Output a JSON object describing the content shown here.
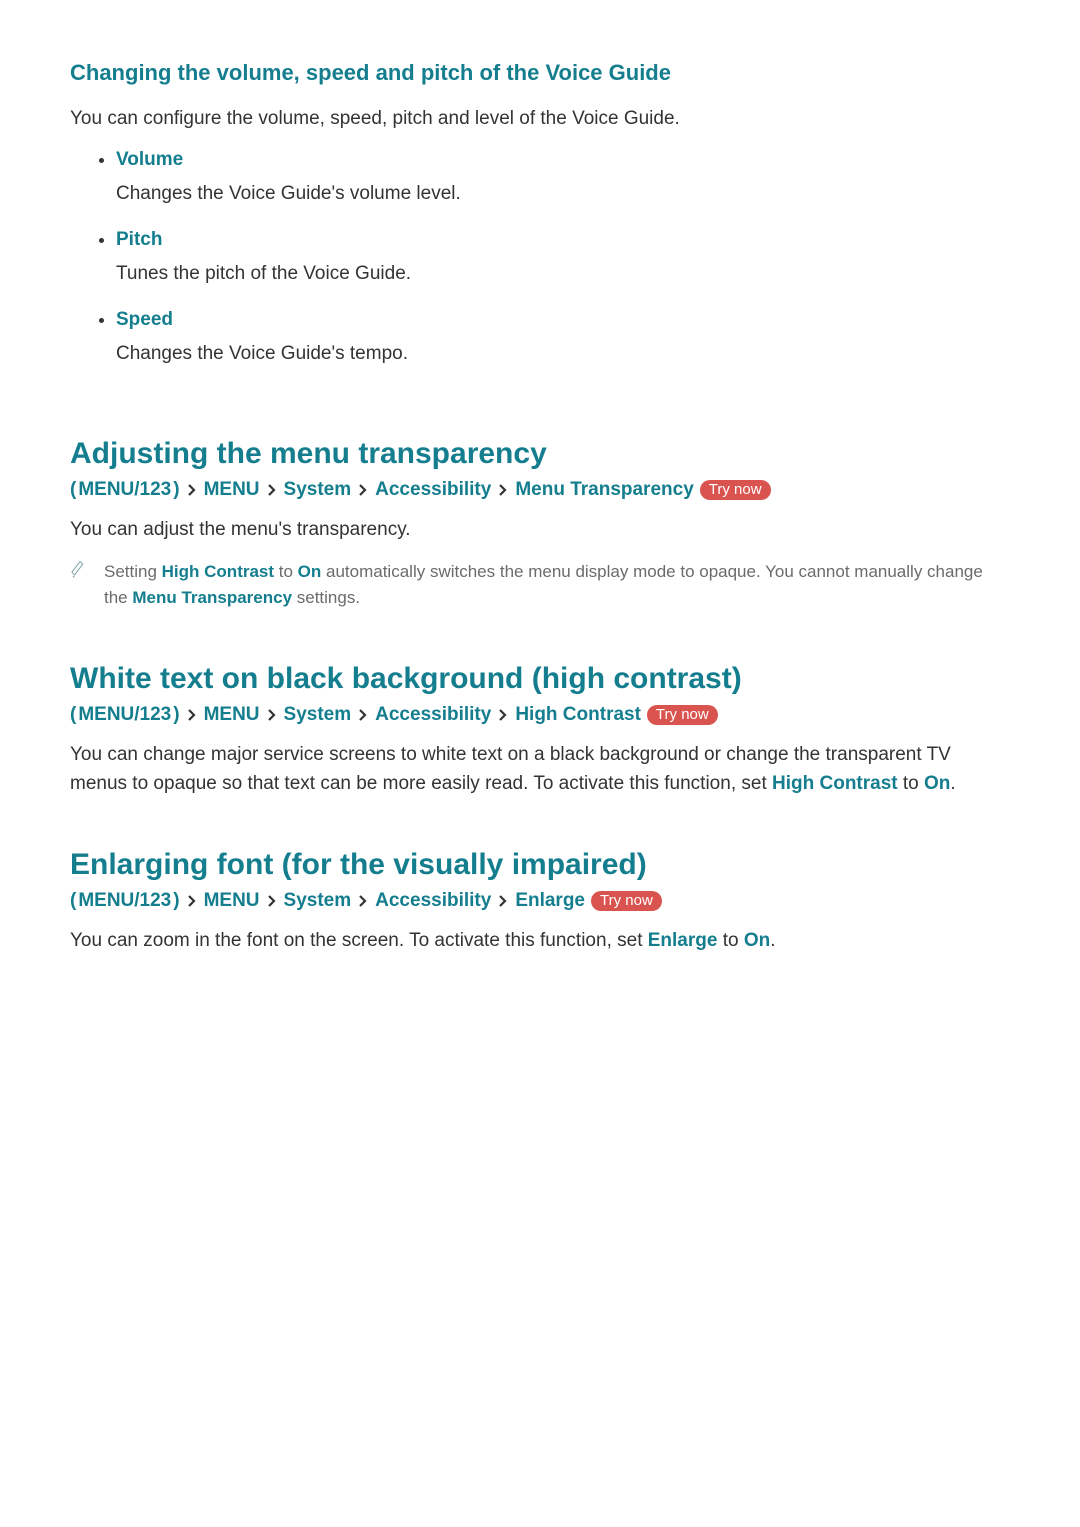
{
  "section1": {
    "heading": "Changing the volume, speed and pitch of the Voice Guide",
    "intro": "You can configure the volume, speed, pitch and level of the Voice Guide.",
    "options": [
      {
        "name": "Volume",
        "desc": "Changes the Voice Guide's volume level."
      },
      {
        "name": "Pitch",
        "desc": "Tunes the pitch of the Voice Guide."
      },
      {
        "name": "Speed",
        "desc": "Changes the Voice Guide's tempo."
      }
    ]
  },
  "section2": {
    "heading": "Adjusting the menu transparency",
    "breadcrumb": {
      "root_prefix": "(",
      "root": "MENU/123",
      "root_suffix": ")",
      "steps": [
        "MENU",
        "System",
        "Accessibility",
        "Menu Transparency"
      ],
      "try_now": "Try now"
    },
    "body": "You can adjust the menu's transparency.",
    "note": {
      "pre": "Setting ",
      "kw1": "High Contrast",
      "mid1": " to ",
      "kw2": "On",
      "mid2": " automatically switches the menu display mode to opaque. You cannot manually change the ",
      "kw3": "Menu Transparency",
      "post": " settings."
    }
  },
  "section3": {
    "heading": "White text on black background (high contrast)",
    "breadcrumb": {
      "root_prefix": "(",
      "root": "MENU/123",
      "root_suffix": ")",
      "steps": [
        "MENU",
        "System",
        "Accessibility",
        "High Contrast"
      ],
      "try_now": "Try now"
    },
    "body": {
      "pre": "You can change major service screens to white text on a black background or change the transparent TV menus to opaque so that text can be more easily read. To activate this function, set ",
      "kw1": "High Contrast",
      "mid": " to ",
      "kw2": "On",
      "post": "."
    }
  },
  "section4": {
    "heading": "Enlarging font (for the visually impaired)",
    "breadcrumb": {
      "root_prefix": "(",
      "root": "MENU/123",
      "root_suffix": ")",
      "steps": [
        "MENU",
        "System",
        "Accessibility",
        "Enlarge"
      ],
      "try_now": "Try now"
    },
    "body": {
      "pre": "You can zoom in the font on the screen. To activate this function, set ",
      "kw1": "Enlarge",
      "mid": " to ",
      "kw2": "On",
      "post": "."
    }
  }
}
